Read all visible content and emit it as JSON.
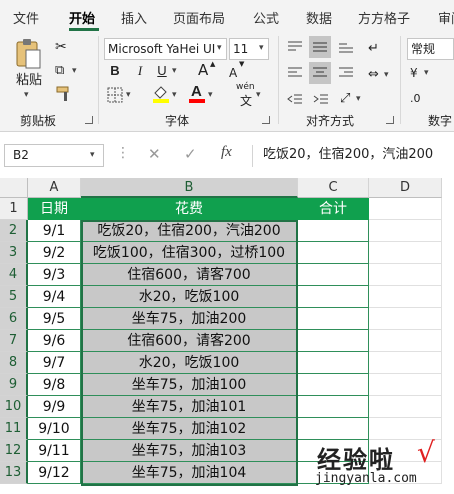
{
  "tabs": [
    "文件",
    "开始",
    "插入",
    "页面布局",
    "公式",
    "数据",
    "方方格子",
    "审阅"
  ],
  "active_tab": "开始",
  "ribbon": {
    "paste_label": "粘贴",
    "clipboard_label": "剪贴板",
    "font_name": "Microsoft YaHei UI",
    "font_size": "11",
    "bold_label": "B",
    "italic_label": "I",
    "underline_label": "U",
    "font_grow": "A",
    "font_shrink": "A",
    "phonetic_label": "wén",
    "font_group_label": "字体",
    "alignment_group_label": "对齐方式",
    "number_format": "常规",
    "number_group_label": "数字",
    "fill_color": "#FFFF00",
    "font_color": "#FF0000"
  },
  "formula_bar": {
    "name_box": "B2",
    "fx_label": "fx",
    "formula": "吃饭20，住宿200，汽油200"
  },
  "columns": [
    "A",
    "B",
    "C",
    "D"
  ],
  "rows": [
    "1",
    "2",
    "3",
    "4",
    "5",
    "6",
    "7",
    "8",
    "9",
    "10",
    "11",
    "12",
    "13"
  ],
  "table": {
    "headers": [
      "日期",
      "花费",
      "合计"
    ],
    "data": [
      [
        "9/1",
        "吃饭20，住宿200，汽油200"
      ],
      [
        "9/2",
        "吃饭100，住宿300，过桥100"
      ],
      [
        "9/3",
        "住宿600，请客700"
      ],
      [
        "9/4",
        "水20，吃饭100"
      ],
      [
        "9/5",
        "坐车75，加油200"
      ],
      [
        "9/6",
        "住宿600，请客200"
      ],
      [
        "9/7",
        "水20，吃饭100"
      ],
      [
        "9/8",
        "坐车75，加油100"
      ],
      [
        "9/9",
        "坐车75，加油101"
      ],
      [
        "9/10",
        "坐车75，加油102"
      ],
      [
        "9/11",
        "坐车75，加油103"
      ],
      [
        "9/12",
        "坐车75，加油104"
      ]
    ]
  },
  "watermark": {
    "main": "经验啦",
    "check": "√",
    "sub": "jingyanla.com"
  },
  "colors": {
    "accent": "#217346",
    "header_fill": "#10A04E",
    "selection_fill": "#C8C8C8"
  }
}
